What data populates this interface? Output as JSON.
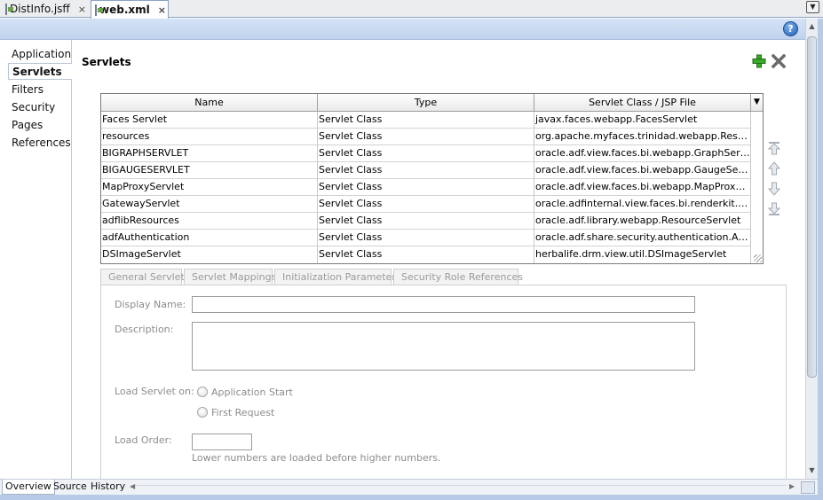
{
  "tabs": [
    {
      "label": "DistInfo.jsff",
      "close": "×"
    },
    {
      "label": "web.xml",
      "close": "×"
    }
  ],
  "nav": {
    "items": [
      "Application",
      "Servlets",
      "Filters",
      "Security",
      "Pages",
      "References"
    ],
    "selected": "Servlets"
  },
  "header": {
    "title": "Servlets",
    "help": "?"
  },
  "table": {
    "columns": [
      "Name",
      "Type",
      "Servlet Class / JSP File"
    ],
    "rows": [
      [
        "Faces Servlet",
        "Servlet Class",
        "javax.faces.webapp.FacesServlet"
      ],
      [
        "resources",
        "Servlet Class",
        "org.apache.myfaces.trinidad.webapp.ResourceServlet"
      ],
      [
        "BIGRAPHSERVLET",
        "Servlet Class",
        "oracle.adf.view.faces.bi.webapp.GraphServlet"
      ],
      [
        "BIGAUGESERVLET",
        "Servlet Class",
        "oracle.adf.view.faces.bi.webapp.GaugeServlet"
      ],
      [
        "MapProxyServlet",
        "Servlet Class",
        "oracle.adf.view.faces.bi.webapp.MapProxyServlet"
      ],
      [
        "GatewayServlet",
        "Servlet Class",
        "oracle.adfinternal.view.faces.bi.renderkit.graph.GatewayServlet"
      ],
      [
        "adflibResources",
        "Servlet Class",
        "oracle.adf.library.webapp.ResourceServlet"
      ],
      [
        "adfAuthentication",
        "Servlet Class",
        "oracle.adf.share.security.authentication.AuthenticationServlet"
      ],
      [
        "DSImageServlet",
        "Servlet Class",
        "herbalife.drm.view.util.DSImageServlet"
      ]
    ]
  },
  "subtabs": [
    "General Servlet",
    "Servlet Mappings",
    "Initialization Parameters",
    "Security Role References"
  ],
  "form": {
    "display_name_label": "Display Name:",
    "display_name_value": "",
    "description_label": "Description:",
    "description_value": "",
    "load_on_label": "Load Servlet on:",
    "load_on_options": [
      "Application Start",
      "First Request"
    ],
    "load_order_label": "Load Order:",
    "load_order_value": "",
    "load_order_hint": "Lower numbers are loaded before higher numbers."
  },
  "bottom_tabs": [
    "Overview",
    "Source",
    "History"
  ],
  "colors": {
    "accent": "#c0d3ee",
    "add_green": "#3aa82a",
    "disabled_text": "#8c8c8c"
  },
  "icons": [
    "file-icon",
    "help-icon",
    "add-icon",
    "delete-icon",
    "move-top-icon",
    "move-up-icon",
    "move-down-icon",
    "move-bottom-icon"
  ]
}
